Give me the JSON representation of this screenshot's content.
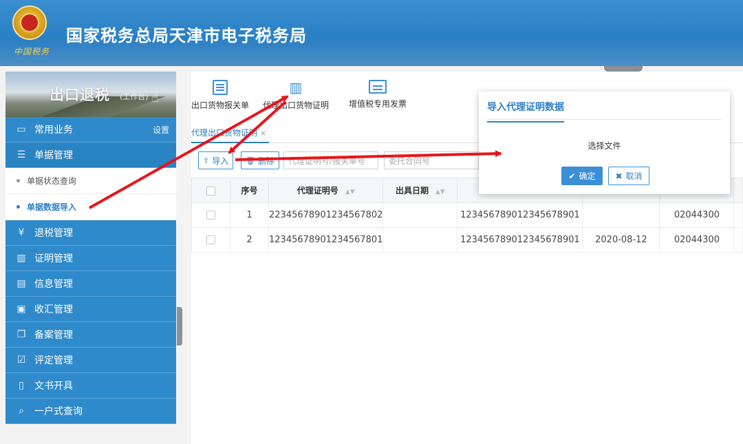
{
  "header": {
    "title": "国家税务总局天津市电子税务局",
    "emblem_text": "中国税务"
  },
  "sidebar": {
    "banner_title": "出口退税",
    "banner_sub": "(工作台)",
    "common": {
      "label": "常用业务",
      "settings": "设置"
    },
    "doc_mgmt": "单据管理",
    "sub_items": [
      "单据状态查询",
      "单据数据导入"
    ],
    "items": [
      "退税管理",
      "证明管理",
      "信息管理",
      "收汇管理",
      "备案管理",
      "评定管理",
      "文书开具",
      "一户式查询"
    ]
  },
  "toolbar": {
    "items": [
      "出口货物报关单",
      "代理出口货物证明",
      "增值税专用发票"
    ]
  },
  "tab": {
    "label": "代理出口货物证明",
    "close": "×"
  },
  "actions": {
    "import_label": "导入",
    "delete_label": "删除",
    "search1_placeholder": "代理证明号/报关单号",
    "search2_placeholder": "委托合同号"
  },
  "table": {
    "headers": [
      "序号",
      "代理证明号",
      "出具日期"
    ],
    "rows": [
      {
        "no": "1",
        "cert": "22345678901234567802",
        "date": "",
        "col4": "12345678901234567890​1",
        "col5": "",
        "col6": "02044300"
      },
      {
        "no": "2",
        "cert": "12345678901234567801",
        "date": "",
        "col4": "12345678901234567890​1",
        "col5": "2020-08-12",
        "col6": "02044300"
      }
    ]
  },
  "dialog": {
    "title": "导入代理证明数据",
    "body": "选择文件",
    "ok": "确定",
    "cancel": "取消"
  },
  "colors": {
    "brand": "#2e8acb",
    "accent": "#3a8fd6",
    "arrow": "#e8141b"
  },
  "icons": [
    "emblem-icon",
    "hand-cursor-icon",
    "briefcase-icon",
    "list-icon",
    "yen-icon",
    "map-icon",
    "book-icon",
    "form-icon",
    "copy-icon",
    "check-box-icon",
    "document-icon",
    "search-icon",
    "invoice-icon",
    "import-icon",
    "delete-icon",
    "check-icon",
    "close-icon"
  ]
}
